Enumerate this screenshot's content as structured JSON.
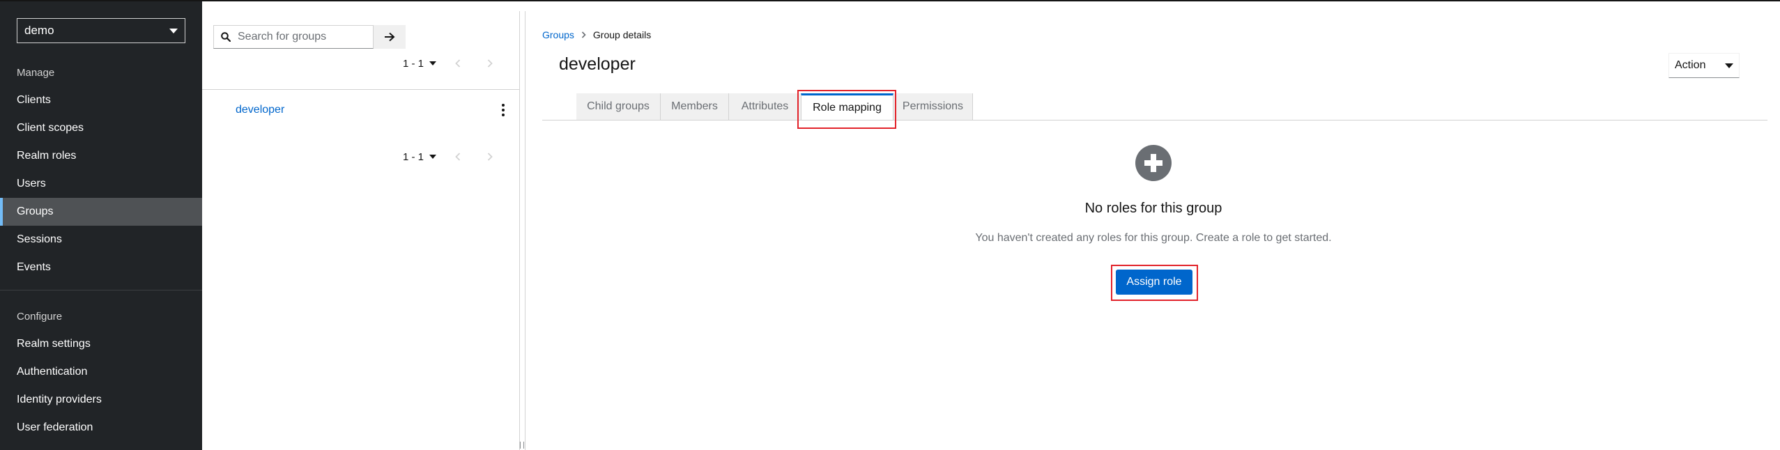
{
  "sidebar": {
    "realm": "demo",
    "sections": [
      {
        "title": "Manage",
        "items": [
          "Clients",
          "Client scopes",
          "Realm roles",
          "Users",
          "Groups",
          "Sessions",
          "Events"
        ]
      },
      {
        "title": "Configure",
        "items": [
          "Realm settings",
          "Authentication",
          "Identity providers",
          "User federation"
        ]
      }
    ],
    "active_item": "Groups"
  },
  "tree": {
    "search_placeholder": "Search for groups",
    "pager_top": "1 - 1",
    "pager_bottom": "1 - 1",
    "groups": [
      "developer"
    ]
  },
  "main": {
    "breadcrumb": [
      "Groups",
      "Group details"
    ],
    "title": "developer",
    "action_label": "Action",
    "tabs": [
      "Child groups",
      "Members",
      "Attributes",
      "Role mapping",
      "Permissions"
    ],
    "active_tab": "Role mapping",
    "empty_state": {
      "title": "No roles for this group",
      "body": "You haven't created any roles for this group. Create a role to get started.",
      "button": "Assign role"
    }
  },
  "colors": {
    "sidebar_bg": "#212427",
    "active_nav_bg": "#4f5255",
    "primary": "#0066cc",
    "highlight": "#e2222a"
  }
}
